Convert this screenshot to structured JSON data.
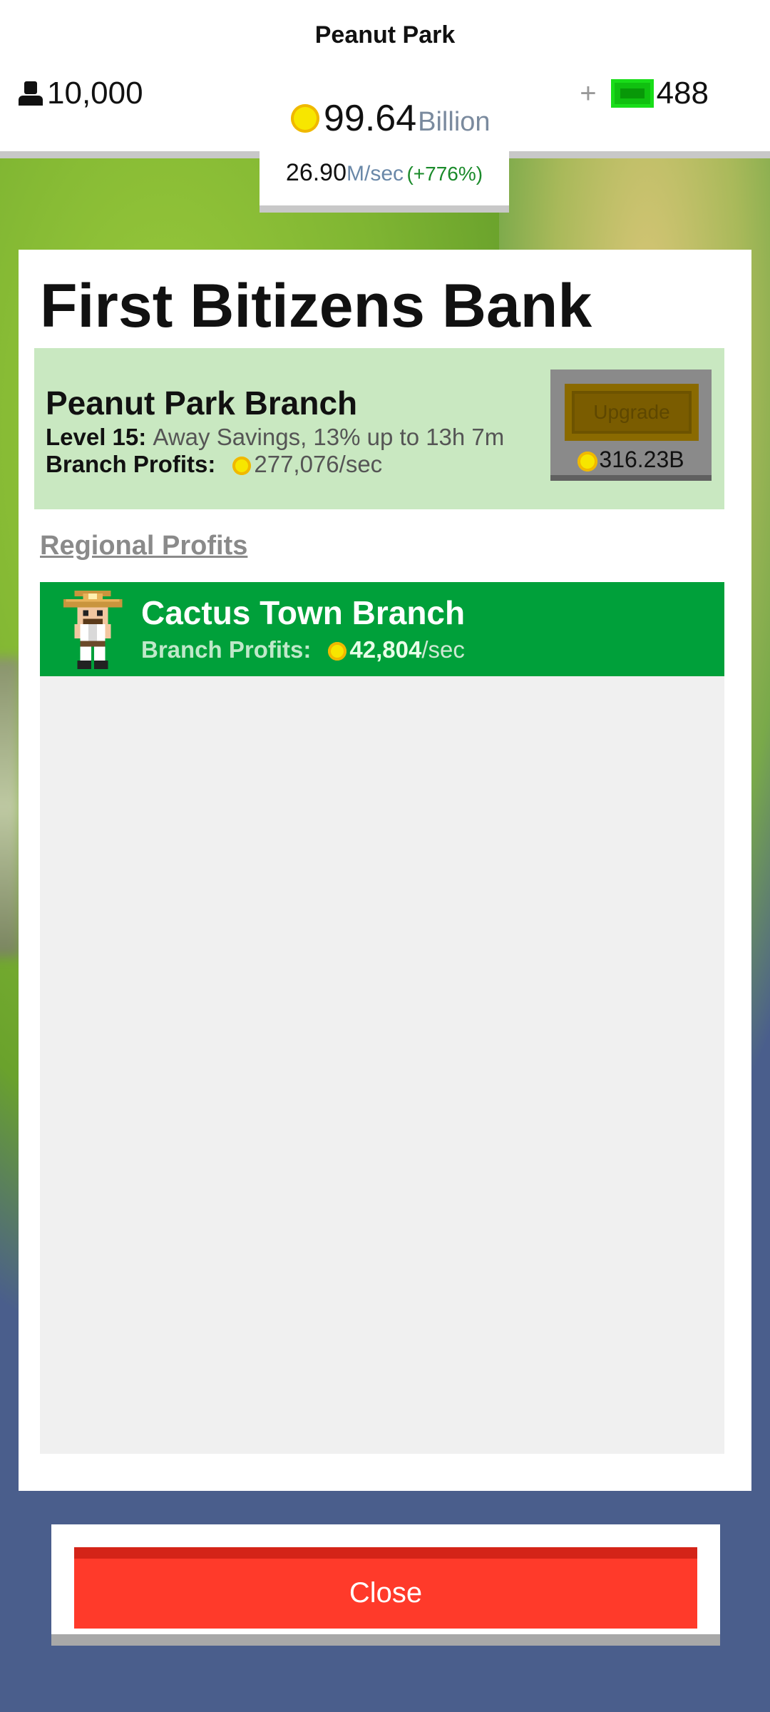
{
  "header": {
    "park_name": "Peanut Park",
    "population": "10,000",
    "money_value": "99.64",
    "money_unit": "Billion",
    "gems_plus": "+",
    "gems": "488",
    "rate_value": "26.90",
    "rate_unit": "M/sec",
    "rate_change": "(+776%)"
  },
  "panel": {
    "title": "First Bitizens Bank",
    "branch": {
      "name": "Peanut Park Branch",
      "level_label": "Level 15:",
      "level_desc": "Away Savings, 13% up to 13h 7m",
      "profits_label": "Branch Profits:",
      "profits_value": "277,076/sec",
      "upgrade_label": "Upgrade",
      "upgrade_cost": "316.23B"
    },
    "regional_label": "Regional Profits",
    "regional_items": [
      {
        "name": "Cactus Town Branch",
        "profits_label": "Branch Profits:",
        "profits_value": "42,804",
        "profits_unit": "/sec"
      }
    ]
  },
  "close_label": "Close",
  "colors": {
    "accent_green": "#00a03a",
    "close_red": "#ff3a2a",
    "branch_card": "#c9e8c1"
  },
  "icons": [
    "person-icon",
    "coin-icon",
    "gem-icon",
    "sheriff-avatar-icon"
  ]
}
